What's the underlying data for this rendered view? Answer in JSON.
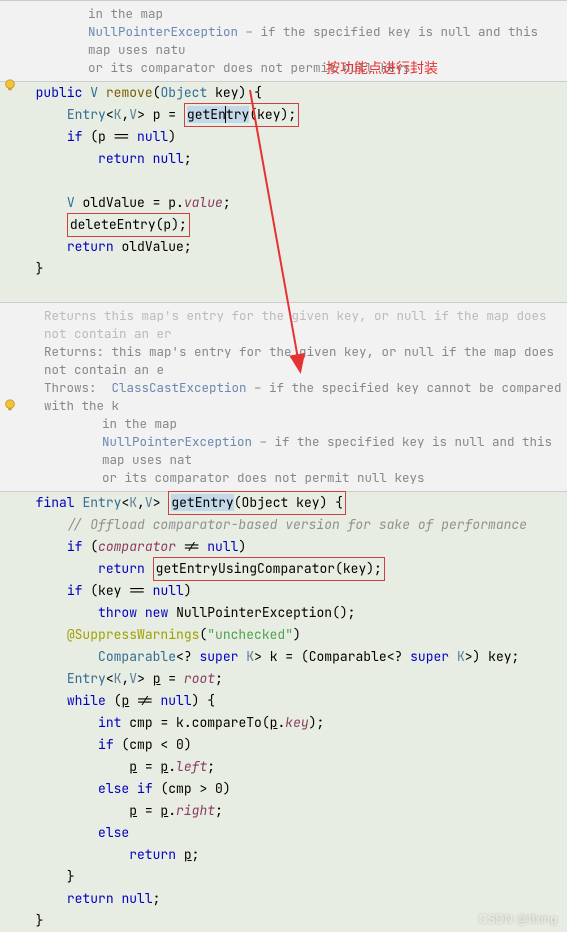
{
  "doc1": {
    "line1_pre": "in the map",
    "ex1": "NullPointerException",
    "ex1_desc": " – if the specified key is null and this map uses natu",
    "line3": "or its comparator does not permit null keys"
  },
  "remove": {
    "public": "public",
    "V": "V",
    "remove": "remove",
    "object": "Object",
    "key": "key",
    "entry": "Entry",
    "K": "K",
    "V2": "V",
    "p": "p",
    "getEntry": "getEntry",
    "key2": "key",
    "if": "if",
    "null": "null",
    "return": "return",
    "null2": "null",
    "oldValue": "oldValue",
    "value": "value",
    "deleteEntry": "deleteEntry",
    "return2": "return"
  },
  "annotation1": "按功能点进行封装",
  "doc2": {
    "ghost": "Returns this map's entry for the given key, or null if the map does not contain an er",
    "returns_label": "Returns:",
    "returns_text": " this map's entry for the given key, or ",
    "returns_null": "null",
    "returns_text2": " if the map does not contain an e",
    "throws_label": "Throws:",
    "ex1": "ClassCastException",
    "ex1_desc": " – if the specified key cannot be compared with the k",
    "line_mid": "in the map",
    "ex2": "NullPointerException",
    "ex2_desc": " – if the specified key is null and this map uses nat",
    "line_last": "or its comparator does not permit null keys"
  },
  "getEntry": {
    "final": "final",
    "Entry": "Entry",
    "K": "K",
    "V": "V",
    "getEntry": "getEntry",
    "Object": "Object",
    "key": "key",
    "comment": "// Offload comparator-based version for sake of performance",
    "if": "if",
    "comparator": "comparator",
    "null": "null",
    "return": "return",
    "getEntryUsing": "getEntryUsingComparator(key);",
    "if2": "if",
    "key2": "key",
    "null2": "null",
    "throw": "throw",
    "new": "new",
    "NPE": "NullPointerException",
    "supp": "@SuppressWarnings",
    "unchecked": "\"unchecked\"",
    "Comparable": "Comparable",
    "super": "super",
    "K2": "K",
    "k": "k",
    "cast": "(Comparable<? ",
    "super2": "super",
    "K3": "K",
    "cast2": ">) key;",
    "Entry2": "Entry",
    "K4": "K",
    "V2": "V",
    "p": "p",
    "root": "root",
    "while": "while",
    "p2": "p",
    "null3": "null",
    "int": "int",
    "cmp": "cmp",
    "compareTo": "compareTo",
    "p3": "p",
    "keyf": "key",
    "if3": "if",
    "lt": "0",
    "p4": "p",
    "p5": "p",
    "left": "left",
    "else": "else",
    "if4": "if",
    "gt": "0",
    "p6": "p",
    "p7": "p",
    "right": "right",
    "else2": "else",
    "return2": "return",
    "p8": "p",
    "return3": "return",
    "null4": "null"
  },
  "watermark": "CSDN @tfxing"
}
